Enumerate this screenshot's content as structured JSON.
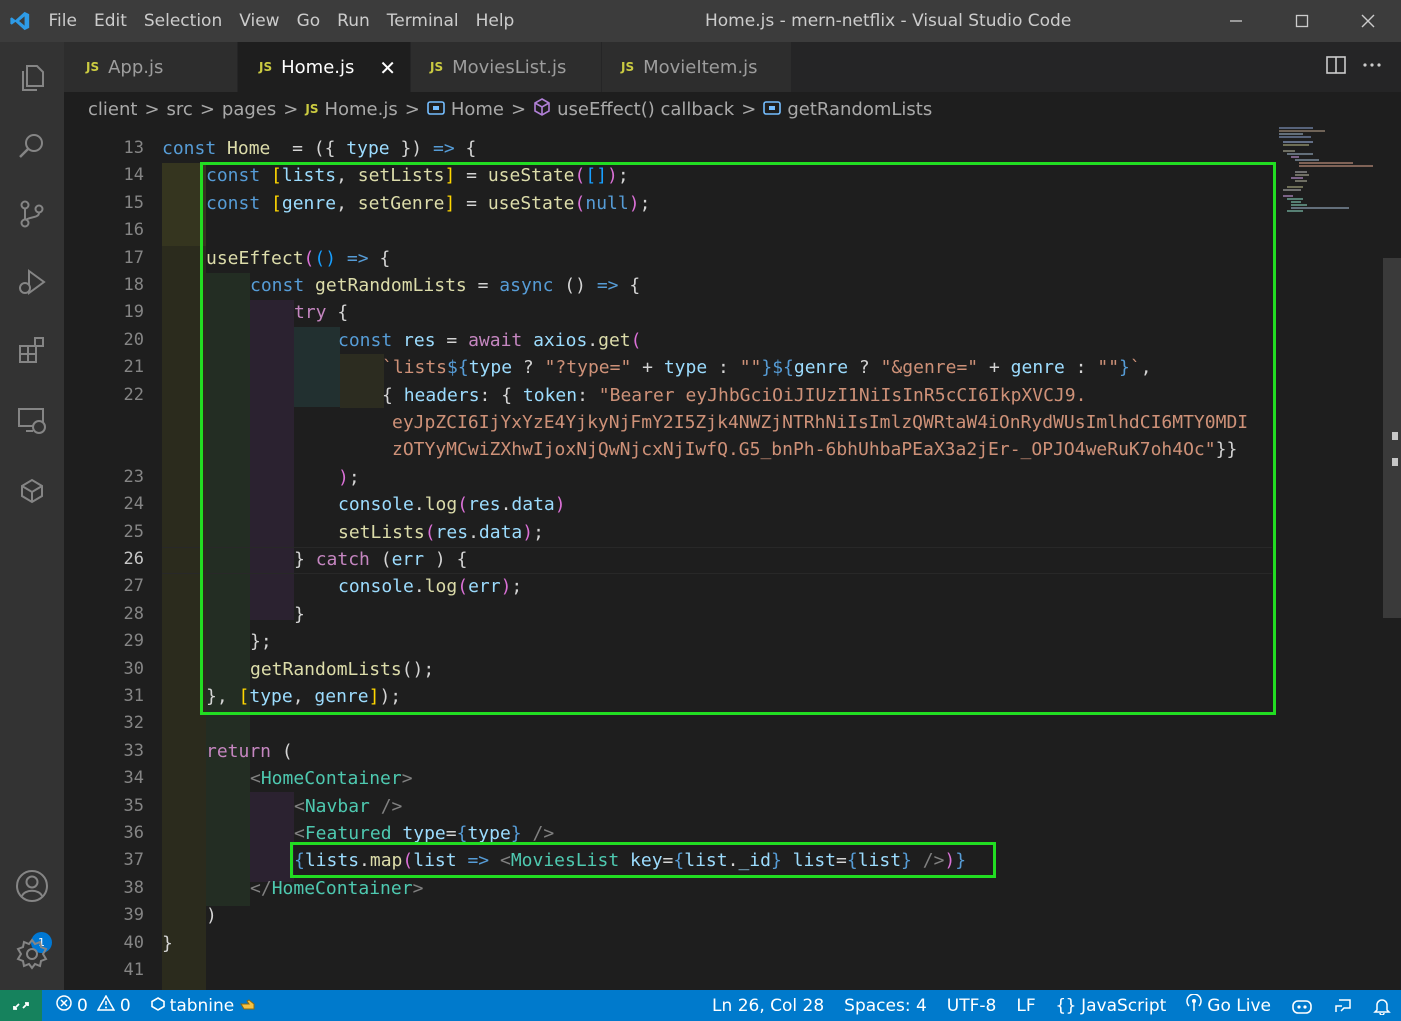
{
  "menu": [
    "File",
    "Edit",
    "Selection",
    "View",
    "Go",
    "Run",
    "Terminal",
    "Help"
  ],
  "window_title": "Home.js - mern-netflix - Visual Studio Code",
  "tabs": [
    {
      "label": "App.js",
      "icon": "JS"
    },
    {
      "label": "Home.js",
      "icon": "JS",
      "active": true,
      "close": "✕"
    },
    {
      "label": "MoviesList.js",
      "icon": "JS"
    },
    {
      "label": "MovieItem.js",
      "icon": "JS"
    }
  ],
  "breadcrumb": {
    "items": [
      "client",
      "src",
      "pages"
    ],
    "file": "Home.js",
    "file_icon": "JS",
    "symbols": [
      "Home",
      "useEffect() callback",
      "getRandomLists"
    ],
    "sep": ">"
  },
  "line_numbers": [
    "13",
    "14",
    "15",
    "16",
    "17",
    "18",
    "19",
    "20",
    "21",
    "22",
    "",
    "",
    "23",
    "24",
    "25",
    "26",
    "27",
    "28",
    "29",
    "30",
    "31",
    "32",
    "33",
    "34",
    "35",
    "36",
    "37",
    "38",
    "39",
    "40",
    "41"
  ],
  "current_line": "26",
  "code_lines": [
    [
      [
        "k",
        "const "
      ],
      [
        "f",
        "Home"
      ],
      [
        "",
        "  = ("
      ],
      [
        "bp",
        ""
      ],
      [
        "",
        "{ "
      ],
      [
        "v",
        "type"
      ],
      [
        "",
        " }) "
      ],
      [
        "k",
        "=>"
      ],
      [
        "",
        " {"
      ]
    ],
    [
      [
        "k",
        "const "
      ],
      [
        "bg",
        "["
      ],
      [
        "v",
        "lists"
      ],
      [
        "",
        ", "
      ],
      [
        "f",
        "setLists"
      ],
      [
        "bg",
        "]"
      ],
      [
        "",
        " = "
      ],
      [
        "f",
        "useState"
      ],
      [
        "bp",
        "("
      ],
      [
        "bb",
        "[]"
      ],
      [
        "bp",
        ")"
      ],
      [
        "",
        ";"
      ]
    ],
    [
      [
        "k",
        "const "
      ],
      [
        "bg",
        "["
      ],
      [
        "v",
        "genre"
      ],
      [
        "",
        ", "
      ],
      [
        "f",
        "setGenre"
      ],
      [
        "bg",
        "]"
      ],
      [
        "",
        " = "
      ],
      [
        "f",
        "useState"
      ],
      [
        "bp",
        "("
      ],
      [
        "k",
        "null"
      ],
      [
        "bp",
        ")"
      ],
      [
        "",
        ";"
      ]
    ],
    [
      [
        "",
        ""
      ]
    ],
    [
      [
        "f",
        "useEffect"
      ],
      [
        "bp",
        "("
      ],
      [
        "bb",
        "()"
      ],
      [
        "",
        " "
      ],
      [
        "k",
        "=>"
      ],
      [
        "",
        " {"
      ]
    ],
    [
      [
        "k",
        "const "
      ],
      [
        "f",
        "getRandomLists"
      ],
      [
        "",
        " = "
      ],
      [
        "k",
        "async"
      ],
      [
        "",
        " () "
      ],
      [
        "k",
        "=>"
      ],
      [
        "",
        " {"
      ]
    ],
    [
      [
        "p",
        "try"
      ],
      [
        "",
        " {"
      ]
    ],
    [
      [
        "k",
        "const "
      ],
      [
        "v",
        "res"
      ],
      [
        "",
        " = "
      ],
      [
        "p",
        "await"
      ],
      [
        "",
        " "
      ],
      [
        "v",
        "axios"
      ],
      [
        "",
        "."
      ],
      [
        "f",
        "get"
      ],
      [
        "bp",
        "("
      ]
    ],
    [
      [
        "s",
        "`lists"
      ],
      [
        "k",
        "${"
      ],
      [
        "v",
        "type"
      ],
      [
        "",
        " ? "
      ],
      [
        "s",
        "\"?type=\""
      ],
      [
        "",
        " + "
      ],
      [
        "v",
        "type"
      ],
      [
        "",
        " : "
      ],
      [
        "s",
        "\"\""
      ],
      [
        "k",
        "}${"
      ],
      [
        "v",
        "genre"
      ],
      [
        "",
        " ? "
      ],
      [
        "s",
        "\"&genre=\""
      ],
      [
        "",
        " + "
      ],
      [
        "v",
        "genre"
      ],
      [
        "",
        " : "
      ],
      [
        "s",
        "\"\""
      ],
      [
        "k",
        "}"
      ],
      [
        "s",
        "`"
      ],
      [
        "",
        ","
      ]
    ],
    [
      [
        "",
        "{ "
      ],
      [
        "v",
        "headers"
      ],
      [
        "",
        ": { "
      ],
      [
        "v",
        "token"
      ],
      [
        "",
        ": "
      ],
      [
        "s",
        "\"Bearer eyJhbGciOiJIUzI1NiIsInR5cCI6IkpXVCJ9."
      ]
    ],
    [
      [
        "s",
        "eyJpZCI6IjYxYzE4YjkyNjFmY2I5Zjk4NWZjNTRhNiIsImlzQWRtaW4iOnRydWUsImlhdCI6MTY0MDI"
      ]
    ],
    [
      [
        "s",
        "zOTYyMCwiZXhwIjoxNjQwNjcxNjIwfQ.G5_bnPh-6bhUhbaPEaX3a2jEr-_OPJO4weRuK7oh4Oc\""
      ],
      [
        "",
        "}}"
      ]
    ],
    [
      [
        "bp",
        ")"
      ],
      [
        "",
        ";"
      ]
    ],
    [
      [
        "v",
        "console"
      ],
      [
        "",
        "."
      ],
      [
        "f",
        "log"
      ],
      [
        "bp",
        "("
      ],
      [
        "v",
        "res"
      ],
      [
        "",
        "."
      ],
      [
        "v",
        "data"
      ],
      [
        "bp",
        ")"
      ]
    ],
    [
      [
        "f",
        "setLists"
      ],
      [
        "bp",
        "("
      ],
      [
        "v",
        "res"
      ],
      [
        "",
        "."
      ],
      [
        "v",
        "data"
      ],
      [
        "bp",
        ")"
      ],
      [
        "",
        ";"
      ]
    ],
    [
      [
        "",
        "} "
      ],
      [
        "p",
        "catch"
      ],
      [
        "",
        " ("
      ],
      [
        "v",
        "err"
      ],
      [
        "",
        " ) {"
      ]
    ],
    [
      [
        "v",
        "console"
      ],
      [
        "",
        "."
      ],
      [
        "f",
        "log"
      ],
      [
        "bp",
        "("
      ],
      [
        "v",
        "err"
      ],
      [
        "bp",
        ")"
      ],
      [
        "",
        ";"
      ]
    ],
    [
      [
        "",
        "}"
      ]
    ],
    [
      [
        "",
        "};"
      ]
    ],
    [
      [
        "f",
        "getRandomLists"
      ],
      [
        "",
        "();"
      ]
    ],
    [
      [
        "",
        "}, "
      ],
      [
        "bg",
        "["
      ],
      [
        "v",
        "type"
      ],
      [
        "",
        ", "
      ],
      [
        "v",
        "genre"
      ],
      [
        "bg",
        "]"
      ],
      [
        "",
        ");"
      ]
    ],
    [
      [
        "",
        ""
      ]
    ],
    [
      [
        "p",
        "return"
      ],
      [
        "",
        " ("
      ]
    ],
    [
      [
        "t",
        "<"
      ],
      [
        "c",
        "HomeContainer"
      ],
      [
        "t",
        ">"
      ]
    ],
    [
      [
        "t",
        "<"
      ],
      [
        "c",
        "Navbar"
      ],
      [
        "",
        " "
      ],
      [
        "t",
        "/>"
      ]
    ],
    [
      [
        "t",
        "<"
      ],
      [
        "c",
        "Featured"
      ],
      [
        "",
        " "
      ],
      [
        "v",
        "type"
      ],
      [
        "",
        "="
      ],
      [
        "k",
        "{"
      ],
      [
        "v",
        "type"
      ],
      [
        "k",
        "}"
      ],
      [
        "",
        " "
      ],
      [
        "t",
        "/>"
      ]
    ],
    [
      [
        "k",
        "{"
      ],
      [
        "v",
        "lists"
      ],
      [
        "",
        "."
      ],
      [
        "f",
        "map"
      ],
      [
        "bp",
        "("
      ],
      [
        "v",
        "list"
      ],
      [
        "",
        " "
      ],
      [
        "k",
        "=>"
      ],
      [
        "",
        " "
      ],
      [
        "t",
        "<"
      ],
      [
        "c",
        "MoviesList"
      ],
      [
        "",
        " "
      ],
      [
        "v",
        "key"
      ],
      [
        "",
        "="
      ],
      [
        "k",
        "{"
      ],
      [
        "v",
        "list"
      ],
      [
        "",
        "."
      ],
      [
        "v",
        "_id"
      ],
      [
        "k",
        "}"
      ],
      [
        "",
        " "
      ],
      [
        "v",
        "list"
      ],
      [
        "",
        "="
      ],
      [
        "k",
        "{"
      ],
      [
        "v",
        "list"
      ],
      [
        "k",
        "}"
      ],
      [
        "",
        " "
      ],
      [
        "t",
        "/>"
      ],
      [
        "bp",
        ")"
      ],
      [
        "k",
        "}"
      ]
    ],
    [
      [
        "t",
        "</"
      ],
      [
        "c",
        "HomeContainer"
      ],
      [
        "t",
        ">"
      ]
    ],
    [
      [
        "",
        ")"
      ]
    ],
    [
      [
        "",
        "}"
      ]
    ],
    [
      [
        "",
        ""
      ]
    ]
  ],
  "status": {
    "errors": "0",
    "warnings": "0",
    "tabnine": "tabnine",
    "position": "Ln 26, Col 28",
    "spaces": "Spaces: 4",
    "encoding": "UTF-8",
    "eol": "LF",
    "language": "JavaScript",
    "golive": "Go Live"
  },
  "account_badge": "1",
  "icons": [
    "vscode-logo-icon",
    "explorer-icon",
    "search-icon",
    "source-control-icon",
    "run-debug-icon",
    "extensions-icon",
    "remote-explorer-icon",
    "docker-icon",
    "account-icon",
    "settings-gear-icon",
    "split-editor-icon",
    "more-actions-icon",
    "remote-indicator-icon",
    "error-icon",
    "warning-icon",
    "copilot-icon",
    "notifications-icon"
  ],
  "colors": {
    "highlight_box": "#22dd22",
    "statusbar": "#007acc",
    "activitybar": "#333333",
    "titlebar": "#3c3c3c"
  }
}
